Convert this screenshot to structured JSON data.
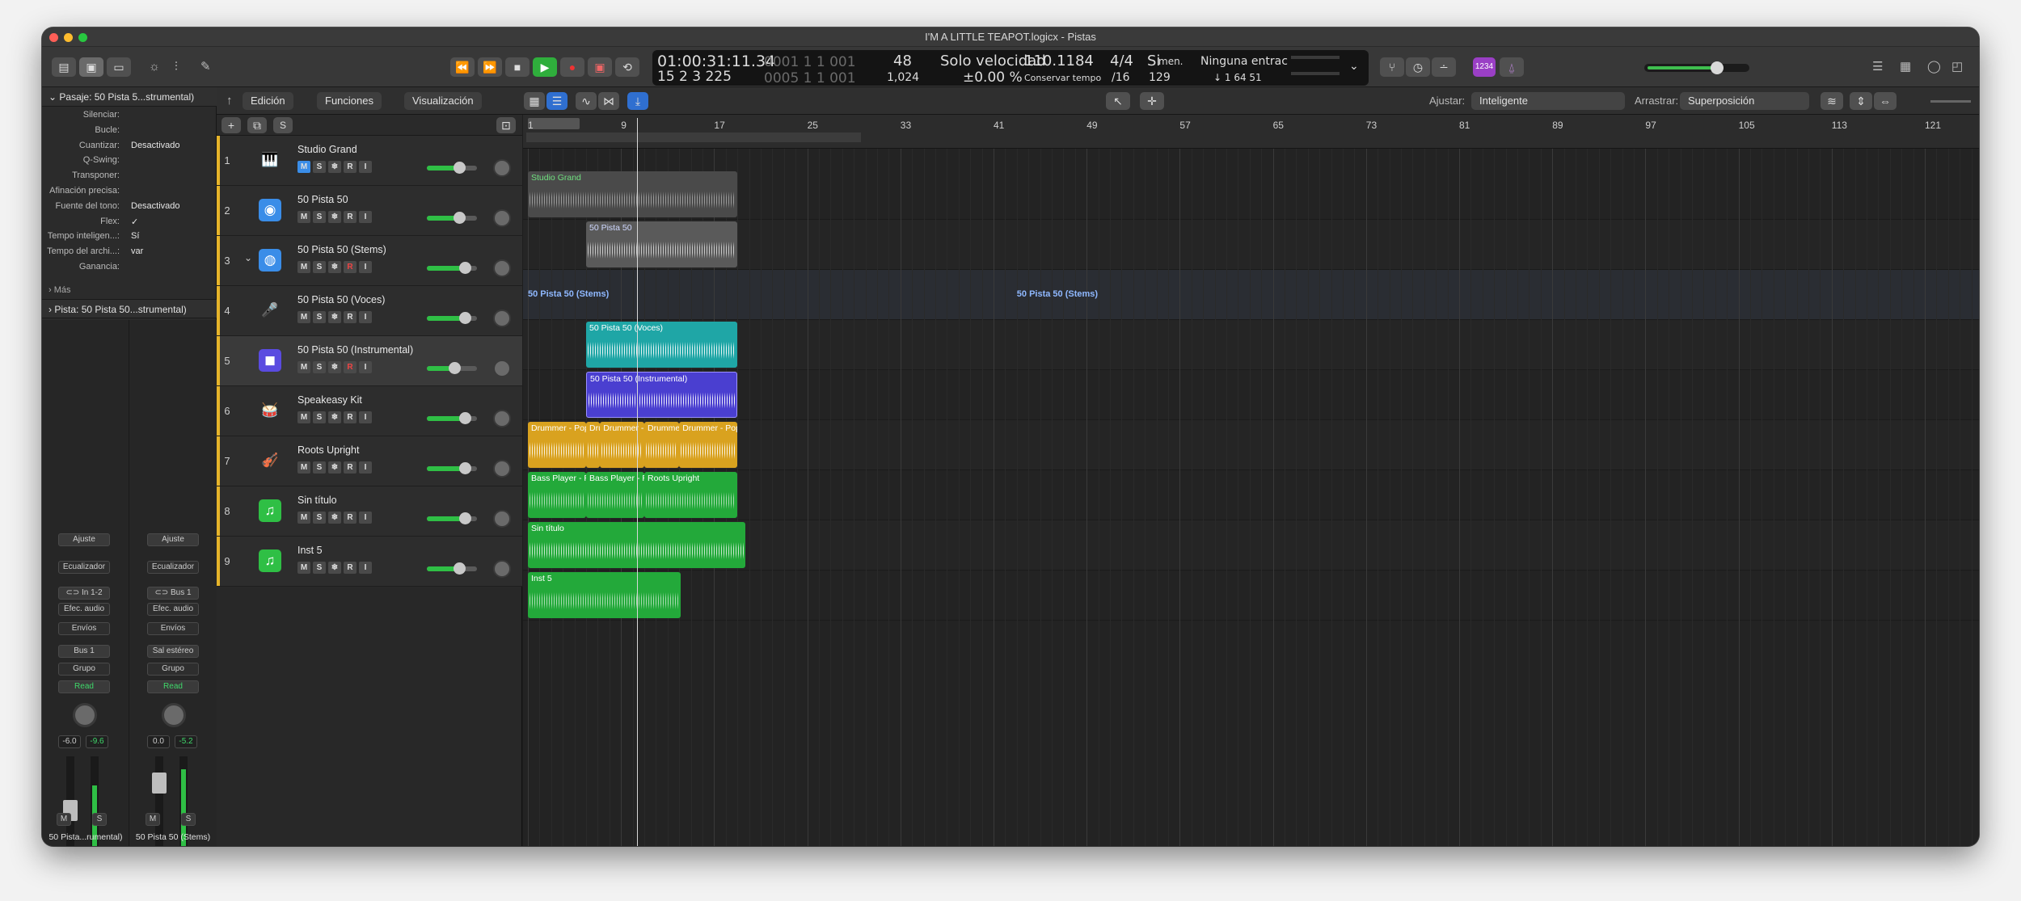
{
  "window": {
    "title": "I'M A LITTLE TEAPOT.logicx - Pistas"
  },
  "lcd": {
    "time": "01:00:31:11.34",
    "time_sub": "0001  1  1  001",
    "bars": "15  2  3  225",
    "bars_sub": "0005  1  1  001",
    "tempo_bpm_top": "48",
    "tempo_bpm_bottom": "1,024",
    "mode": "Solo velocidad",
    "mode_sub": "±0.00 %",
    "tempo": "110.1184",
    "tempo_sub": "Conservar tempo",
    "sig": "4/4",
    "sig_sub": "/16",
    "key": "Si",
    "key_sub": "men.",
    "key_num": "129",
    "chord": "Ninguna entrac",
    "chord_sub": "↓  1  64  51",
    "count_badge": "1234"
  },
  "inspector": {
    "region_header": "Pasaje:  50 Pista 5...strumental)",
    "rows": [
      {
        "label": "Silenciar:",
        "value": ""
      },
      {
        "label": "Bucle:",
        "value": ""
      },
      {
        "label": "Cuantizar:",
        "value": "Desactivado"
      },
      {
        "label": "Q-Swing:",
        "value": ""
      },
      {
        "label": "Transponer:",
        "value": ""
      },
      {
        "label": "Afinación precisa:",
        "value": ""
      },
      {
        "label": "Fuente del tono:",
        "value": "Desactivado"
      },
      {
        "label": "Flex:",
        "value": "✓"
      },
      {
        "label": "Tempo inteligen...:",
        "value": "Sí"
      },
      {
        "label": "Tempo del archi...:",
        "value": "var"
      },
      {
        "label": "Ganancia:",
        "value": ""
      }
    ],
    "more": "Más",
    "track_header": "Pista:  50 Pista 50...strumental)",
    "strip1": {
      "ajuste": "Ajuste",
      "eq": "Ecualizador",
      "input": "In 1-2",
      "fx": "Efec. audio",
      "sends": "Envíos",
      "output": "Bus 1",
      "group": "Grupo",
      "auto": "Read",
      "vol": "-6.0",
      "peak": "-9.6",
      "name": "50 Pista...rumental)"
    },
    "strip2": {
      "ajuste": "Ajuste",
      "eq": "Ecualizador",
      "input": "Bus 1",
      "fx": "Efec. audio",
      "sends": "Envíos",
      "output": "Sal estéreo",
      "group": "Grupo",
      "auto": "Read",
      "vol": "0.0",
      "peak": "-5.2",
      "name": "50 Pista 50 (Stems)"
    },
    "m": "M",
    "s": "S"
  },
  "menus": {
    "edit": "Edición",
    "functions": "Funciones",
    "view": "Visualización",
    "snap_label": "Ajustar:",
    "snap_value": "Inteligente",
    "drag_label": "Arrastrar:",
    "drag_value": "Superposición"
  },
  "track_buttons": {
    "m": "M",
    "s": "S",
    "r": "R",
    "i": "I"
  },
  "tracks": [
    {
      "num": "1",
      "name": "Studio Grand",
      "icon": "piano-icon",
      "color": "#3fbf4f"
    },
    {
      "num": "2",
      "name": "50 Pista 50",
      "icon": "waveform-icon",
      "color": "#3a8de8"
    },
    {
      "num": "3",
      "name": "50 Pista 50 (Stems)",
      "icon": "stems-icon",
      "color": "#3a8de8"
    },
    {
      "num": "4",
      "name": "50 Pista 50 (Voces)",
      "icon": "microphone-icon",
      "color": "#2bb8b8"
    },
    {
      "num": "5",
      "name": "50 Pista 50 (Instrumental)",
      "icon": "instrument-icon",
      "color": "#5a4be0"
    },
    {
      "num": "6",
      "name": "Speakeasy Kit",
      "icon": "drums-icon",
      "color": "#e6b42a"
    },
    {
      "num": "7",
      "name": "Roots Upright",
      "icon": "bass-icon",
      "color": "#e6b42a"
    },
    {
      "num": "8",
      "name": "Sin título",
      "icon": "note-icon",
      "color": "#2fbf45"
    },
    {
      "num": "9",
      "name": "Inst 5",
      "icon": "note-icon",
      "color": "#2fbf45"
    }
  ],
  "ruler": {
    "bars": [
      "1",
      "9",
      "17",
      "25",
      "33",
      "41",
      "49",
      "57",
      "65",
      "73",
      "81",
      "89",
      "97",
      "105",
      "113",
      "121"
    ]
  },
  "regions": {
    "r1": "Studio Grand",
    "r2": "50 Pista 50",
    "r3a": "50 Pista 50 (Stems)",
    "r3b": "50 Pista 50 (Stems)",
    "r4": "50 Pista 50 (Voces)",
    "r5": "50 Pista 50 (Instrumental)",
    "r6a": "Drummer - Pop Brush",
    "r6b": "Dru",
    "r6c": "Drummer - Pop",
    "r6d": "Drummer -",
    "r6e": "Drummer - Pop Brush",
    "r7a": "Bass Player - Roots U",
    "r7b": "Bass Player - Roots U",
    "r7c": "Roots Upright",
    "r8": "Sin título",
    "r9": "Inst 5"
  }
}
